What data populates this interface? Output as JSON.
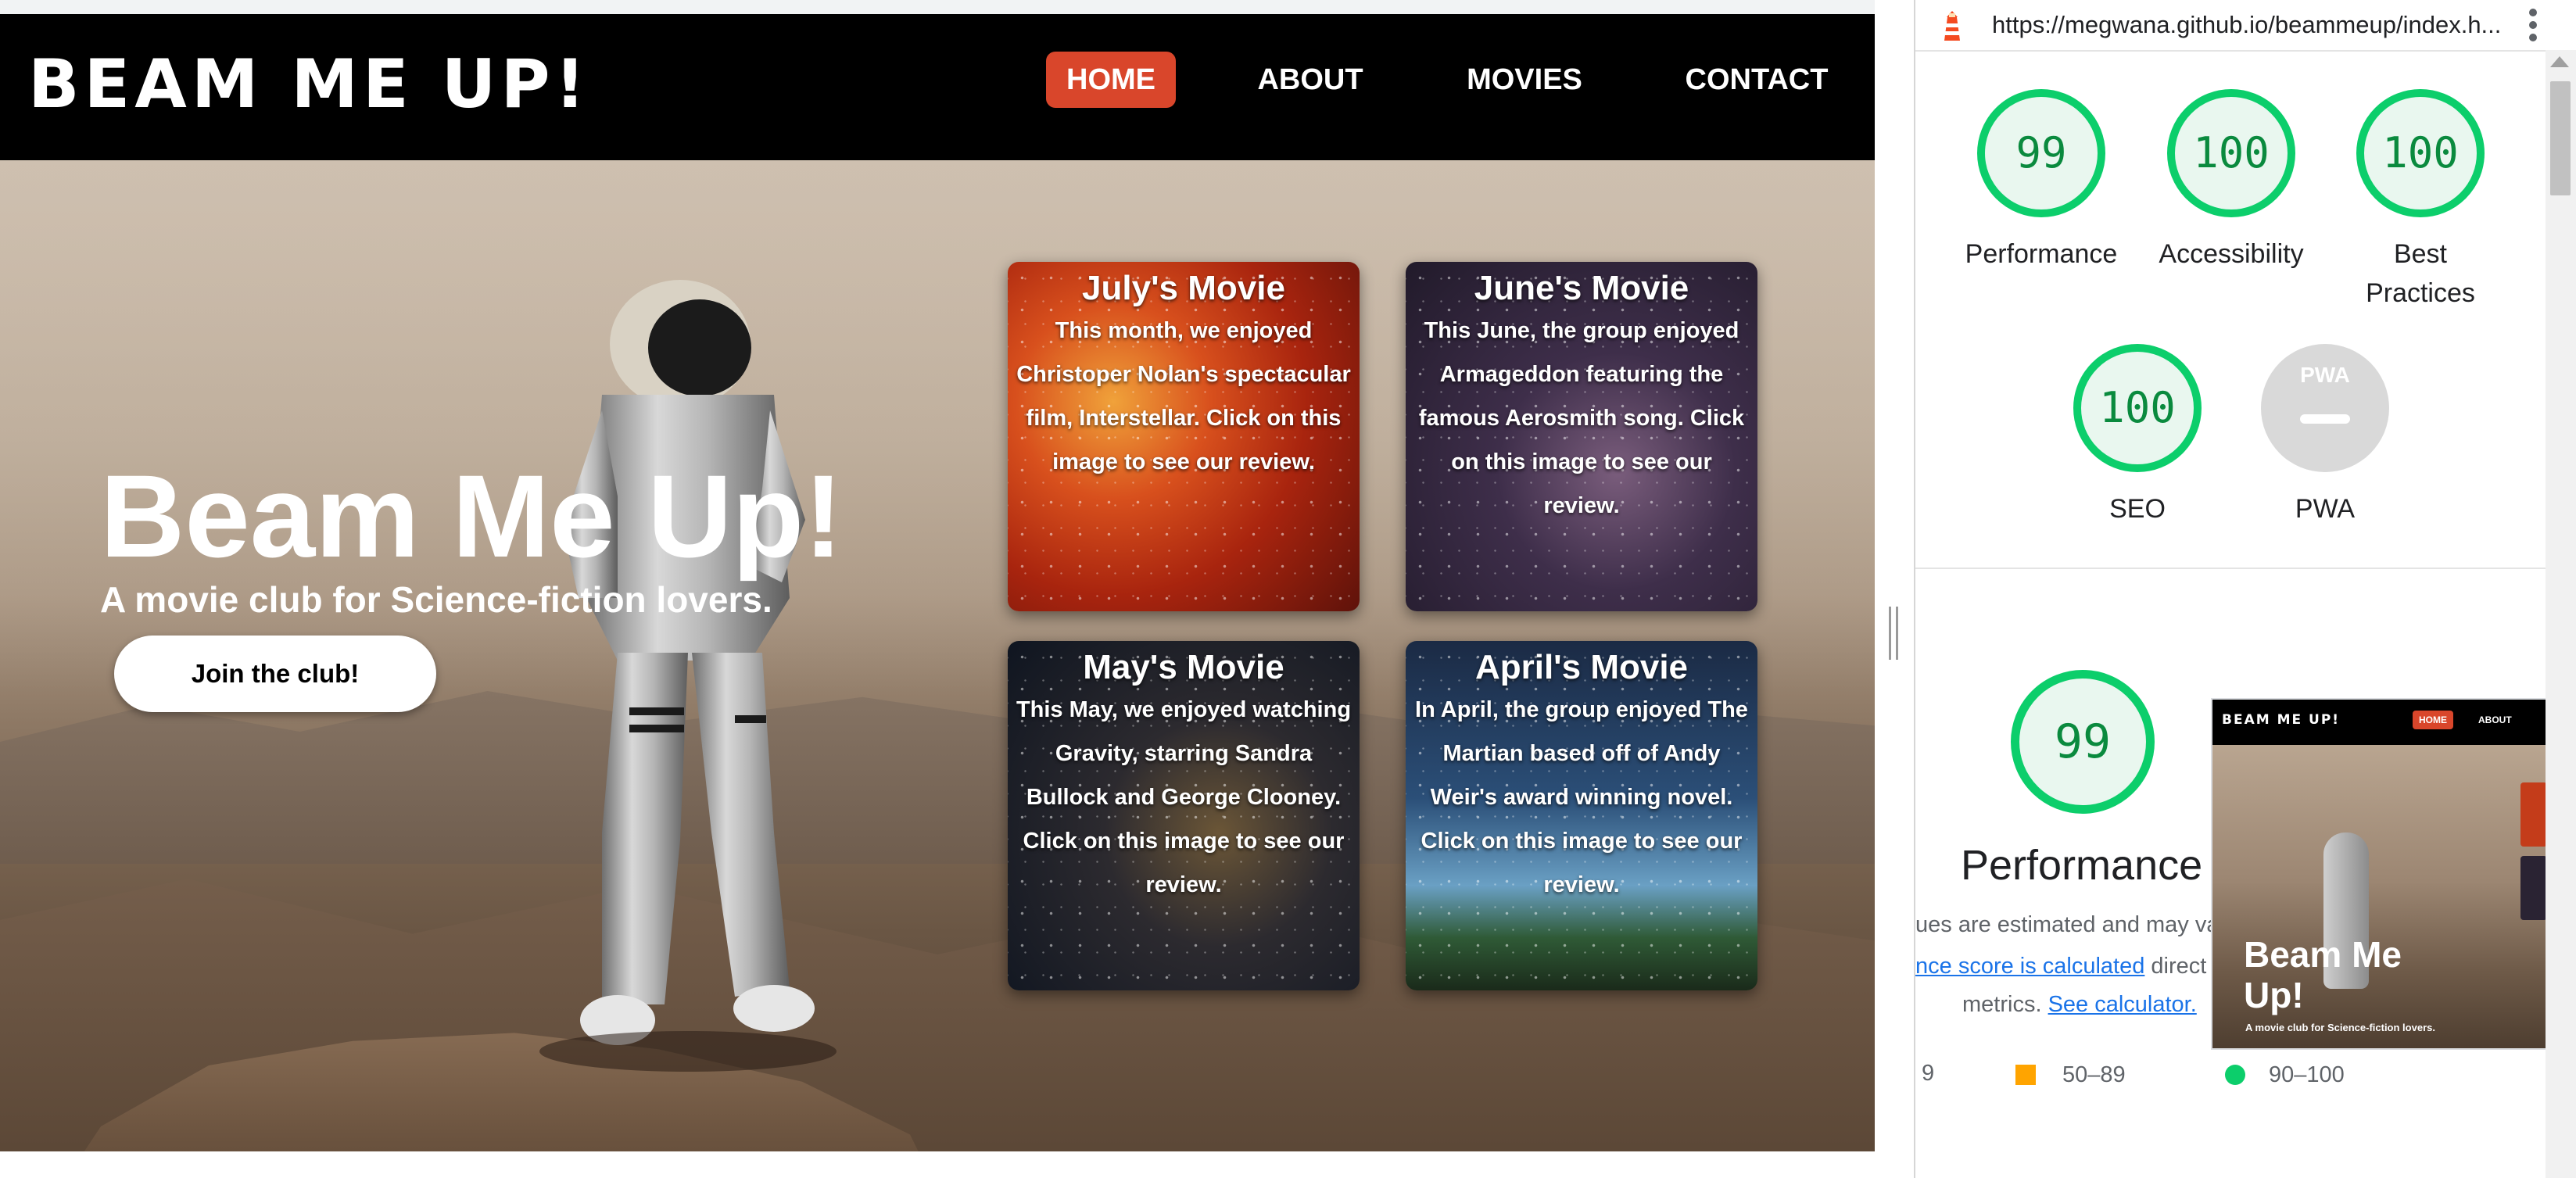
{
  "site": {
    "brand": "BEAM ME UP!",
    "nav": {
      "home": "HOME",
      "about": "ABOUT",
      "movies": "MOVIES",
      "contact": "CONTACT"
    },
    "hero": {
      "title": "Beam Me Up!",
      "subtitle": "A movie club for Science-fiction lovers.",
      "join_button": "Join the club!"
    },
    "cards": [
      {
        "title": "July's Movie",
        "text": "This month, we enjoyed Christoper Nolan's spectacular film, Interstellar. Click on this image to see our review."
      },
      {
        "title": "June's Movie",
        "text": "This June, the group enjoyed Armageddon featuring the famous Aerosmith song. Click on this image to see our review."
      },
      {
        "title": "May's Movie",
        "text": "This May, we enjoyed watching Gravity, starring Sandra Bullock and George Clooney. Click on this image to see our review."
      },
      {
        "title": "April's Movie",
        "text": "In April, the group enjoyed The Martian based off of Andy Weir's award winning novel. Click on this image to see our review."
      }
    ],
    "colors": {
      "accent": "#d9462b",
      "navbar": "#000000"
    }
  },
  "lighthouse": {
    "url": "https://megwana.github.io/beammeup/index.h...",
    "icons": {
      "lighthouse": "lighthouse-icon",
      "more": "more-vert-icon"
    },
    "scores": {
      "performance": {
        "value": "99",
        "label": "Performance"
      },
      "accessibility": {
        "value": "100",
        "label": "Accessibility"
      },
      "best_practices": {
        "value": "100",
        "label_line1": "Best",
        "label_line2": "Practices"
      },
      "seo": {
        "value": "100",
        "label": "SEO"
      },
      "pwa": {
        "badge": "PWA",
        "label": "PWA"
      }
    },
    "detail": {
      "score": "99",
      "heading": "Performance",
      "desc_line1": "ues are estimated and may va",
      "desc_link1": "nce score is calculated",
      "desc_line2_after": " direct",
      "desc_line3": "metrics. ",
      "desc_link2": "See calculator."
    },
    "legend": {
      "fail_partial": "9",
      "average": "50–89",
      "pass": "90–100"
    },
    "thumbnail": {
      "brand": "BEAM ME UP!",
      "home": "HOME",
      "about": "ABOUT",
      "title": "Beam Me Up!",
      "subtitle": "A movie club for Science-fiction lovers."
    },
    "colors": {
      "pass": "#0cce6b",
      "average": "#ffa400",
      "pass_text": "#0a8a3e",
      "link": "#1a73e8"
    }
  }
}
